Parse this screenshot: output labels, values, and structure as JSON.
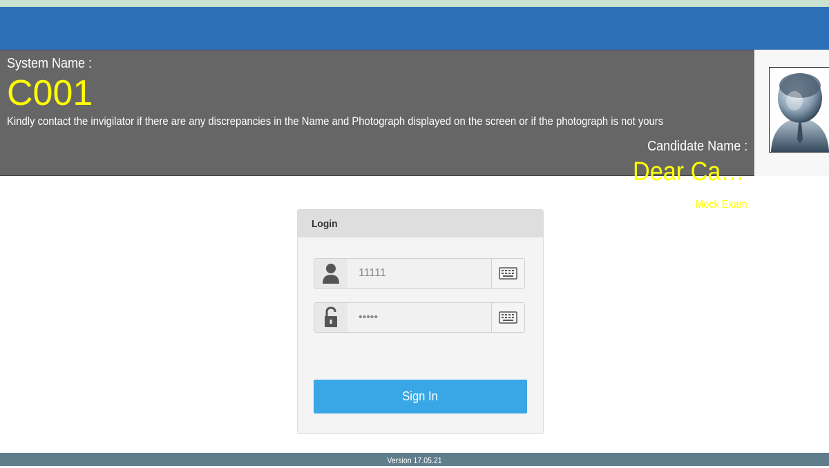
{
  "header": {
    "system_name_label": "System Name :",
    "system_name": "C001",
    "notice": "Kindly contact the invigilator if there are any discrepancies in the Name and Photograph displayed on the screen or if the photograph is not yours",
    "candidate_name_label": "Candidate Name :",
    "candidate_name": "Dear Ca…",
    "exam_name": "Mock Exam",
    "photo_icon": "candidate-avatar-icon"
  },
  "login": {
    "title": "Login",
    "username": {
      "value": "11111",
      "icon": "user-icon"
    },
    "password": {
      "value": "•••••",
      "icon": "lock-icon"
    },
    "keyboard_icon": "keyboard-icon",
    "sign_in_label": "Sign In"
  },
  "footer": {
    "version": "Version 17.05.21"
  },
  "colors": {
    "header_blue": "#2d6fb7",
    "panel_gray": "#666666",
    "highlight_yellow": "#ffff00",
    "button_blue": "#39a6e6",
    "footer_slate": "#607d8b"
  }
}
